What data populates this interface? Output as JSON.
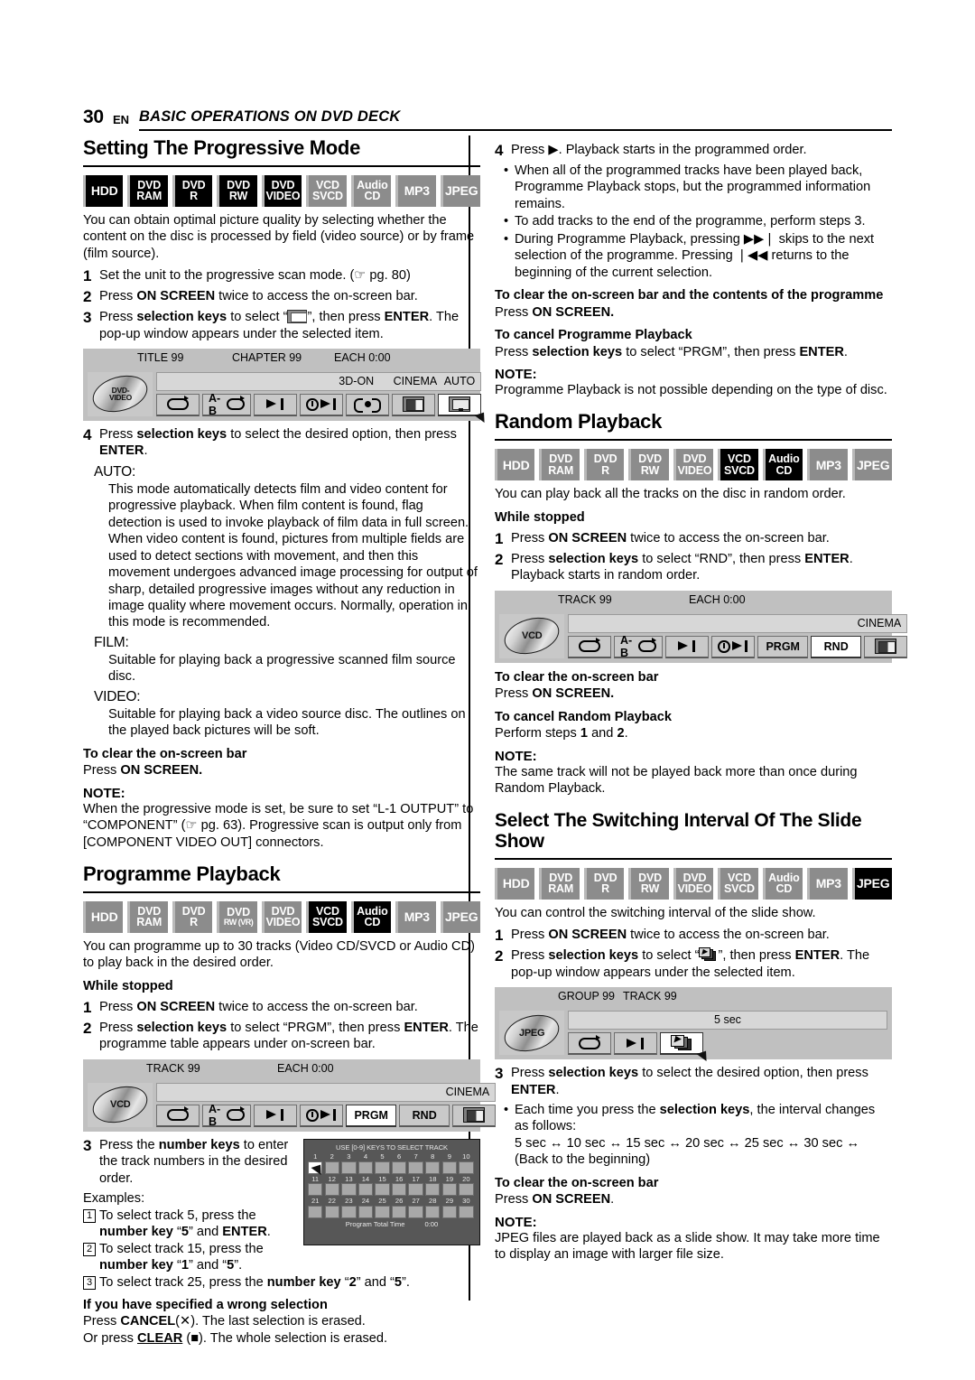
{
  "header": {
    "page_number": "30",
    "lang": "EN",
    "title": "BASIC OPERATIONS ON DVD DECK"
  },
  "badge_labels": {
    "hdd": "HDD",
    "dvd": "DVD",
    "ram": "RAM",
    "r": "R",
    "rw": "RW",
    "rw_vr": "RW (VR)",
    "video": "VIDEO",
    "vcd": "VCD",
    "svcd": "SVCD",
    "audio": "Audio",
    "cd": "CD",
    "mp3": "MP3",
    "jpeg": "JPEG"
  },
  "sections": {
    "progressive": {
      "heading": "Setting The Progressive Mode",
      "intro": "You can obtain optimal picture quality by selecting whether the content on the disc is processed by field (video source) or by frame (film source).",
      "step1_num": "1",
      "step1": "Set the unit to the progressive scan mode. (☞ pg. 80)",
      "step2_num": "2",
      "step2_a": "Press ",
      "step2_b": "ON SCREEN",
      "step2_c": " twice to access the on-screen bar.",
      "step3_num": "3",
      "step3_a": "Press ",
      "step3_b": "selection keys",
      "step3_c": " to select “",
      "step3_d": "”, then press ",
      "step3_e": "ENTER",
      "step3_f": ". The pop-up window appears under the selected item.",
      "step4_num": "4",
      "step4_a": "Press ",
      "step4_b": "selection keys",
      "step4_c": " to select the desired option, then press ",
      "step4_d": "ENTER",
      "step4_e": ".",
      "defs": [
        {
          "term": "AUTO:",
          "body": "This mode automatically detects film and video content for progressive playback. When film content is found, flag detection is used to invoke playback of film data in full screen. When video content is found, pictures from multiple fields are used to detect sections with movement, and then this movement undergoes advanced image processing for output of sharp, detailed progressive images without any reduction in image quality where movement occurs. Normally, operation in this mode is recommended."
        },
        {
          "term": "FILM:",
          "body": "Suitable for playing back a progressive scanned film source disc."
        },
        {
          "term": "VIDEO:",
          "body": "Suitable for playing back a video source disc. The outlines on the played back pictures will be soft."
        }
      ],
      "clear_head": "To clear the on-screen bar",
      "clear_a": "Press ",
      "clear_b": "ON SCREEN.",
      "note_head": "NOTE:",
      "note_body": "When the progressive mode is set, be sure to set “L-1 OUTPUT” to “COMPONENT” (☞ pg. 63). Progressive scan is output only from [COMPONENT VIDEO OUT] connectors."
    },
    "programme": {
      "heading": "Programme Playback",
      "intro": "You can programme up to 30 tracks (Video CD/SVCD or Audio CD) to play back in the desired order.",
      "while_stopped": "While stopped",
      "step1_num": "1",
      "step1_a": "Press ",
      "step1_b": "ON SCREEN",
      "step1_c": " twice to access the on-screen bar.",
      "step2_num": "2",
      "step2_a": "Press ",
      "step2_b": "selection keys",
      "step2_c": " to select “PRGM”, then press ",
      "step2_d": "ENTER",
      "step2_e": ". The programme table appears under on-screen bar.",
      "step3_num": "3",
      "step3_a": "Press the ",
      "step3_b": "number keys",
      "step3_c": " to enter the track numbers in the desired order.",
      "examples_label": "Examples:",
      "ex1_num": "1",
      "ex1_a": "To select track 5, press the ",
      "ex1_b": "number key",
      "ex1_c": " “",
      "ex1_d": "5",
      "ex1_e": "” and ",
      "ex1_f": "ENTER",
      "ex1_g": ".",
      "ex2_num": "2",
      "ex2_a": "To select track 15, press the ",
      "ex2_b": "number key",
      "ex2_c": " “",
      "ex2_d": "1",
      "ex2_e": "” and “",
      "ex2_f": "5",
      "ex2_g": "”.",
      "ex3_num": "3",
      "ex3_a": "To select track 25, press the ",
      "ex3_b": "number key",
      "ex3_c": " “",
      "ex3_d": "2",
      "ex3_e": "” and “",
      "ex3_f": "5",
      "ex3_g": "”.",
      "wrong_head": "If you have specified a wrong selection",
      "wrong_l1_a": "Press ",
      "wrong_l1_b": "CANCEL",
      "wrong_l1_c": "(✕). The last selection is erased.",
      "wrong_l2_a": "Or press ",
      "wrong_l2_b": "CLEAR",
      "wrong_l2_c": " (■). The whole selection is erased.",
      "step4_num": "4",
      "step4_a": "Press ",
      "step4_b": "▶",
      "step4_c": ". Playback starts in the programmed order.",
      "bullets": [
        "When all of the programmed tracks have been played back, Programme Playback stops, but the programmed information remains.",
        "To add tracks to the end of the programme, perform steps 3.",
        "During Programme Playback, pressing ▶▶❘ skips to the next selection of the programme. Pressing ❘◀◀ returns to the beginning of the current selection."
      ],
      "clear_head": "To clear the on-screen bar and the contents of the programme",
      "clear_a": "Press ",
      "clear_b": "ON SCREEN.",
      "cancel_head": "To cancel Programme Playback",
      "cancel_a": "Press ",
      "cancel_b": "selection keys",
      "cancel_c": " to select “PRGM”, then press ",
      "cancel_d": "ENTER",
      "cancel_e": ".",
      "note_head": "NOTE:",
      "note_body": "Programme Playback is not possible depending on the type of disc."
    },
    "random": {
      "heading": "Random Playback",
      "intro": "You can play back all the tracks on the disc in random order.",
      "while_stopped": "While stopped",
      "step1_num": "1",
      "step1_a": "Press ",
      "step1_b": "ON SCREEN",
      "step1_c": " twice to access the on-screen bar.",
      "step2_num": "2",
      "step2_a": "Press ",
      "step2_b": "selection keys",
      "step2_c": " to select “RND”, then press ",
      "step2_d": "ENTER",
      "step2_e": ". Playback starts in random order.",
      "clear_head": "To clear the on-screen bar",
      "clear_a": "Press ",
      "clear_b": "ON SCREEN.",
      "cancel_head": "To cancel Random Playback",
      "cancel_a": "Perform steps ",
      "cancel_b": "1",
      "cancel_c": " and ",
      "cancel_d": "2",
      "cancel_e": ".",
      "note_head": "NOTE:",
      "note_body": "The same track will not be played back more than once during Random Playback."
    },
    "slideshow": {
      "heading": "Select The Switching Interval Of The Slide Show",
      "intro": "You can control the switching interval of the slide show.",
      "step1_num": "1",
      "step1_a": "Press ",
      "step1_b": "ON SCREEN",
      "step1_c": " twice to access the on-screen bar.",
      "step2_num": "2",
      "step2_a": "Press ",
      "step2_b": "selection keys",
      "step2_c": " to select “",
      "step2_d": "”, then press ",
      "step2_e": "ENTER",
      "step2_f": ". The pop-up window appears under the selected item.",
      "step3_num": "3",
      "step3_a": "Press ",
      "step3_b": "selection keys",
      "step3_c": " to select the desired option, then press ",
      "step3_d": "ENTER",
      "step3_e": ".",
      "bullet_a": "Each time you press the ",
      "bullet_b": "selection keys",
      "bullet_c": ", the interval changes as follows:",
      "interval_seq": "5 sec ↔ 10 sec ↔ 15 sec ↔ 20 sec ↔ 25 sec ↔ 30 sec ↔ (Back to the beginning)",
      "clear_head": "To clear the on-screen bar",
      "clear_a": "Press ",
      "clear_b": "ON SCREEN",
      "clear_c": ".",
      "note_head": "NOTE:",
      "note_body": "JPEG files are played back as a slide show. It may take more time to display an image with larger file size."
    }
  },
  "osb_dvd": {
    "top_title": "TITLE 99",
    "top_chapter": "CHAPTER 99",
    "top_each": "EACH 0:00",
    "disc_l1": "DVD-",
    "disc_l2": "VIDEO",
    "status_3d": "3D-ON",
    "status_cinema": "CINEMA",
    "status_auto": "AUTO",
    "btn_ab": "A-B"
  },
  "osb_vcd_prgm": {
    "top_track": "TRACK 99",
    "top_each": "EACH 0:00",
    "disc": "VCD",
    "status_cinema": "CINEMA",
    "btn_ab": "A-B",
    "btn_prgm": "PRGM",
    "btn_rnd": "RND"
  },
  "osb_vcd_rnd": {
    "top_track": "TRACK 99",
    "top_each": "EACH 0:00",
    "disc": "VCD",
    "status_cinema": "CINEMA",
    "btn_ab": "A-B",
    "btn_prgm": "PRGM",
    "btn_rnd": "RND"
  },
  "osb_jpeg": {
    "top_group": "GROUP 99",
    "top_track": "TRACK 99",
    "disc": "JPEG",
    "status_sec": "5 sec"
  },
  "programme_table": {
    "title": "USE [0-9] KEYS TO SELECT TRACK",
    "rows": [
      [
        "1",
        "2",
        "3",
        "4",
        "5",
        "6",
        "7",
        "8",
        "9",
        "10"
      ],
      [
        "11",
        "12",
        "13",
        "14",
        "15",
        "16",
        "17",
        "18",
        "19",
        "20"
      ],
      [
        "21",
        "22",
        "23",
        "24",
        "25",
        "26",
        "27",
        "28",
        "29",
        "30"
      ]
    ],
    "selected": "1",
    "footer_label": "Program Total Time",
    "footer_value": "0:00"
  },
  "colors": {
    "badge_active": "#000000",
    "badge_inactive": "#8c8c8c",
    "osb_bg": "#c0c0c0",
    "table_bg": "#575757"
  }
}
